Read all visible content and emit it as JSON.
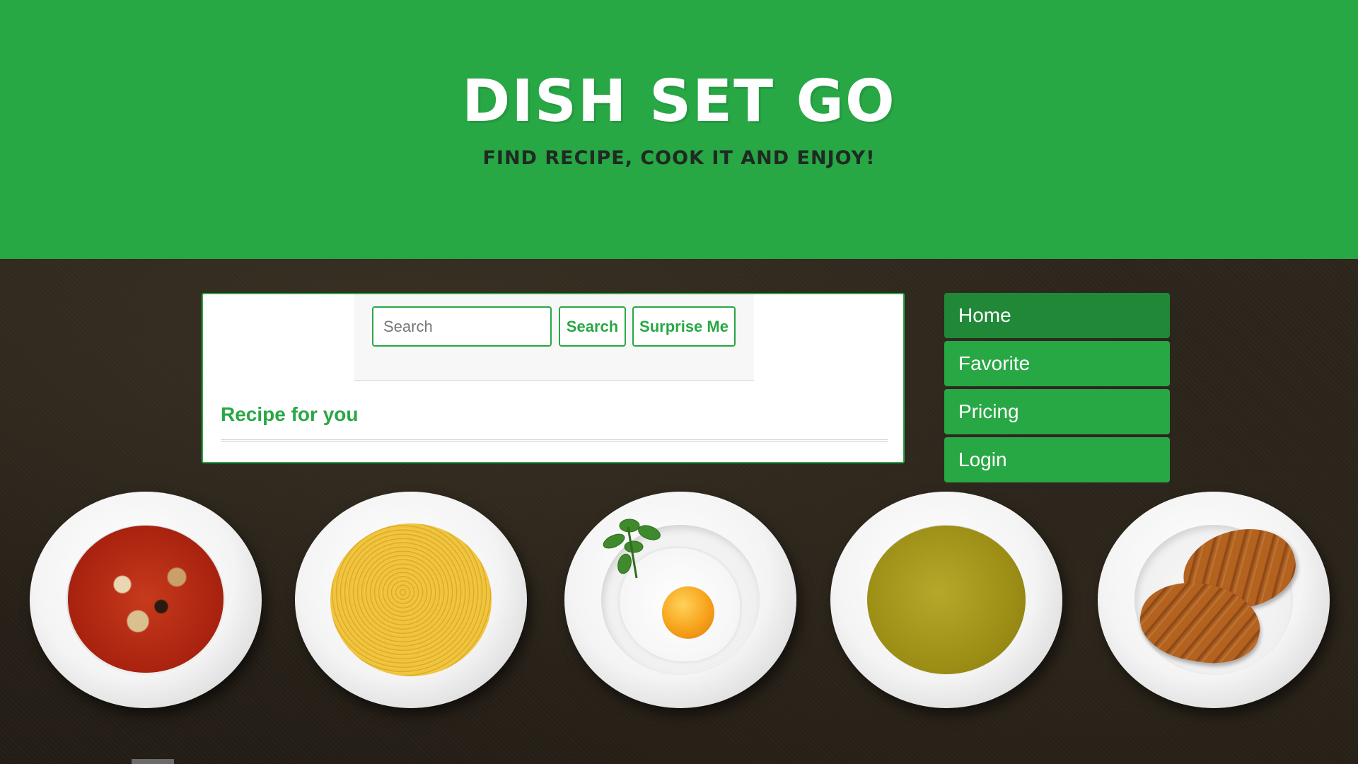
{
  "header": {
    "title": "Dish set go",
    "tagline": "Find recipe, cook it and enjoy!"
  },
  "search": {
    "placeholder": "Search",
    "value": "",
    "search_label": "Search",
    "surprise_label": "Surprise Me"
  },
  "content": {
    "section_title": "Recipe for you"
  },
  "nav": {
    "items": [
      {
        "label": "Home",
        "active": true
      },
      {
        "label": "Favorite",
        "active": false
      },
      {
        "label": "Pricing",
        "active": false
      },
      {
        "label": "Login",
        "active": false
      }
    ]
  },
  "theme": {
    "accent": "#28a745",
    "accent_dark": "#218838",
    "background": "#2a231a"
  },
  "plates": [
    {
      "icon": "minestrone-soup-plate"
    },
    {
      "icon": "spaghetti-plate"
    },
    {
      "icon": "fried-egg-plate"
    },
    {
      "icon": "green-soup-plate"
    },
    {
      "icon": "croissant-plate"
    }
  ]
}
